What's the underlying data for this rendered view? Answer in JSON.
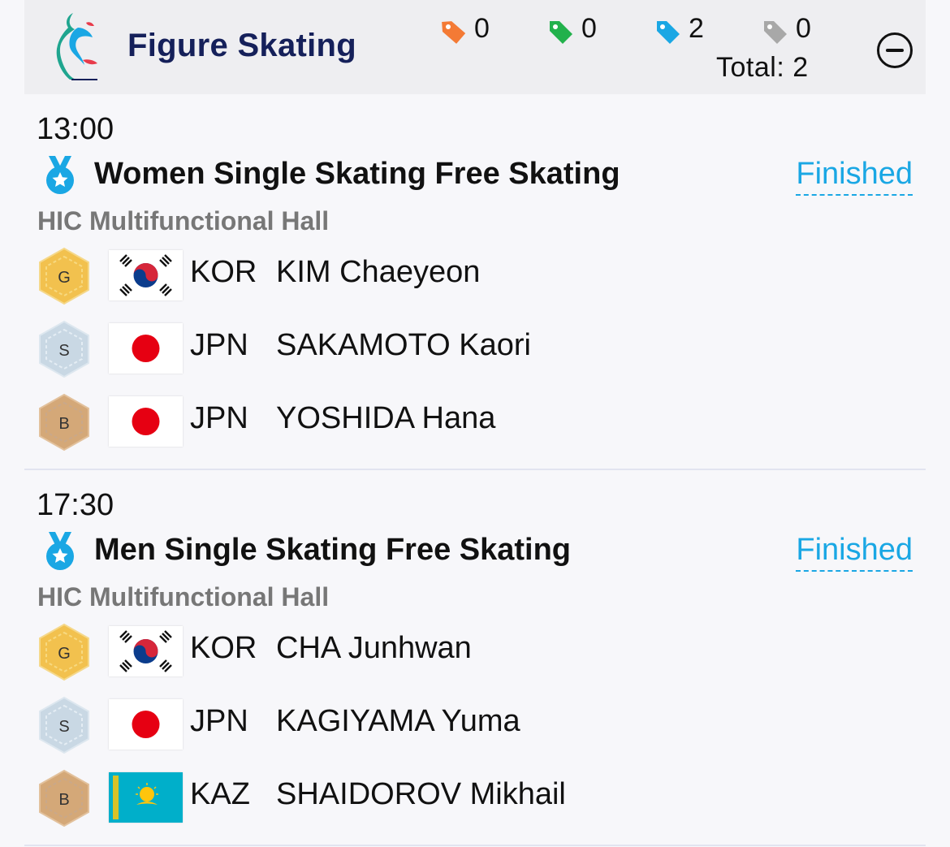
{
  "header": {
    "title": "Figure Skating",
    "tags": [
      {
        "icon": "orange-tag-icon",
        "color": "#f47a35",
        "count": "0"
      },
      {
        "icon": "green-tag-icon",
        "color": "#22b14c",
        "count": "0"
      },
      {
        "icon": "blue-tag-icon",
        "color": "#1aa7e4",
        "count": "2"
      },
      {
        "icon": "gray-tag-icon",
        "color": "#a8a8a8",
        "count": "0"
      }
    ],
    "total_label": "Total:",
    "total_value": "2"
  },
  "events": [
    {
      "time": "13:00",
      "name": "Women Single Skating Free Skating",
      "status": "Finished",
      "venue": "HIC Multifunctional Hall",
      "results": [
        {
          "medal": "G",
          "noc": "KOR",
          "athlete": "KIM Chaeyeon"
        },
        {
          "medal": "S",
          "noc": "JPN",
          "athlete": "SAKAMOTO Kaori"
        },
        {
          "medal": "B",
          "noc": "JPN",
          "athlete": "YOSHIDA Hana"
        }
      ]
    },
    {
      "time": "17:30",
      "name": "Men Single Skating Free Skating",
      "status": "Finished",
      "venue": "HIC Multifunctional Hall",
      "results": [
        {
          "medal": "G",
          "noc": "KOR",
          "athlete": "CHA Junhwan"
        },
        {
          "medal": "S",
          "noc": "JPN",
          "athlete": "KAGIYAMA Yuma"
        },
        {
          "medal": "B",
          "noc": "KAZ",
          "athlete": "SHAIDOROV Mikhail"
        }
      ]
    }
  ],
  "colors": {
    "accent": "#1aa7e4",
    "title": "#15205a",
    "venue": "#777777",
    "gold": "#f2c14e",
    "silver": "#c9d8e4",
    "bronze": "#d4a878"
  }
}
